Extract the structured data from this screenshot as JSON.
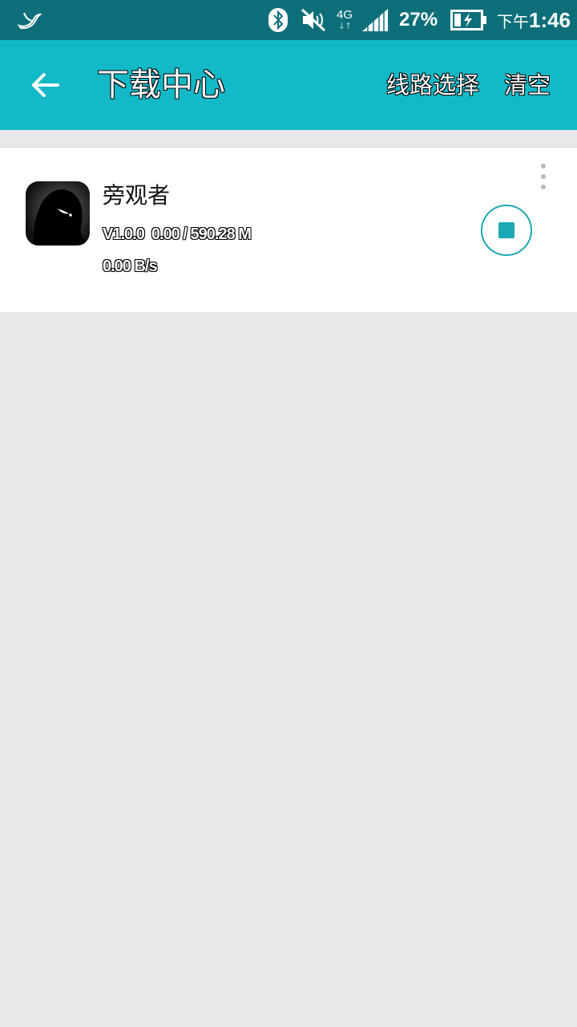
{
  "status_bar": {
    "network_type": "4G",
    "network_arrows": "↓↑",
    "battery_percent": "27%",
    "time_ampm": "下午",
    "time": "1:46",
    "icons": [
      "swallow-logo-icon",
      "bluetooth-icon",
      "mute-icon",
      "signal-icon",
      "battery-charging-icon"
    ]
  },
  "app_bar": {
    "title": "下载中心",
    "route_select_label": "线路选择",
    "clear_label": "清空",
    "background_color": "#14b9c8"
  },
  "downloads": [
    {
      "name": "旁观者",
      "meta": "V1.0.0  0.00 / 590.28 M",
      "speed": "0.00 B/s",
      "accent_color": "#1aa8b5"
    }
  ]
}
